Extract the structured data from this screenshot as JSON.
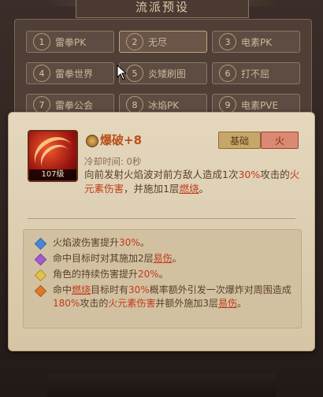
{
  "header": {
    "title": "流派预设"
  },
  "presets": [
    {
      "num": "1",
      "label": "雷拳PK"
    },
    {
      "num": "2",
      "label": "无尽"
    },
    {
      "num": "3",
      "label": "电素PK"
    },
    {
      "num": "4",
      "label": "雷拳世界"
    },
    {
      "num": "5",
      "label": "炎矮刷图"
    },
    {
      "num": "6",
      "label": "打不屈"
    },
    {
      "num": "7",
      "label": "雷拳公会"
    },
    {
      "num": "8",
      "label": "冰焰PK"
    },
    {
      "num": "9",
      "label": "电素PVE"
    }
  ],
  "skill": {
    "name": "爆破+8",
    "level": "107级",
    "tags": [
      "基础",
      "火"
    ],
    "cooldown": "冷却时间: 0秒",
    "desc": {
      "p1": "向前发射火焰波对前方敌人造成1次",
      "pct": "30%",
      "p2": "攻击的",
      "elem": "火元素伤害",
      "p3": "，并施加1层",
      "burn": "燃烧",
      "p4": "。"
    }
  },
  "effects": [
    {
      "color": "#4a86d8",
      "parts": [
        {
          "t": "火焰波伤害提升"
        },
        {
          "t": "30%",
          "red": true
        },
        {
          "t": "。"
        }
      ]
    },
    {
      "color": "#a45ad0",
      "parts": [
        {
          "t": "命中目标时对其施加2层"
        },
        {
          "t": "易伤",
          "u": true
        },
        {
          "t": "。"
        }
      ]
    },
    {
      "color": "#e2c24a",
      "parts": [
        {
          "t": "角色的持续伤害提升"
        },
        {
          "t": "20%",
          "red": true
        },
        {
          "t": "。"
        }
      ]
    },
    {
      "color": "#e0782a",
      "parts": [
        {
          "t": "命中"
        },
        {
          "t": "燃烧",
          "u": true
        },
        {
          "t": "目标时有"
        },
        {
          "t": "30%",
          "red": true
        },
        {
          "t": "概率额外引发一次爆炸对周围造成"
        },
        {
          "t": "180%",
          "red": true
        },
        {
          "t": "攻击的"
        },
        {
          "t": "火元素伤害",
          "red": true
        },
        {
          "t": "并额外施加3层"
        },
        {
          "t": "易伤",
          "u": true
        },
        {
          "t": "。"
        }
      ]
    }
  ]
}
